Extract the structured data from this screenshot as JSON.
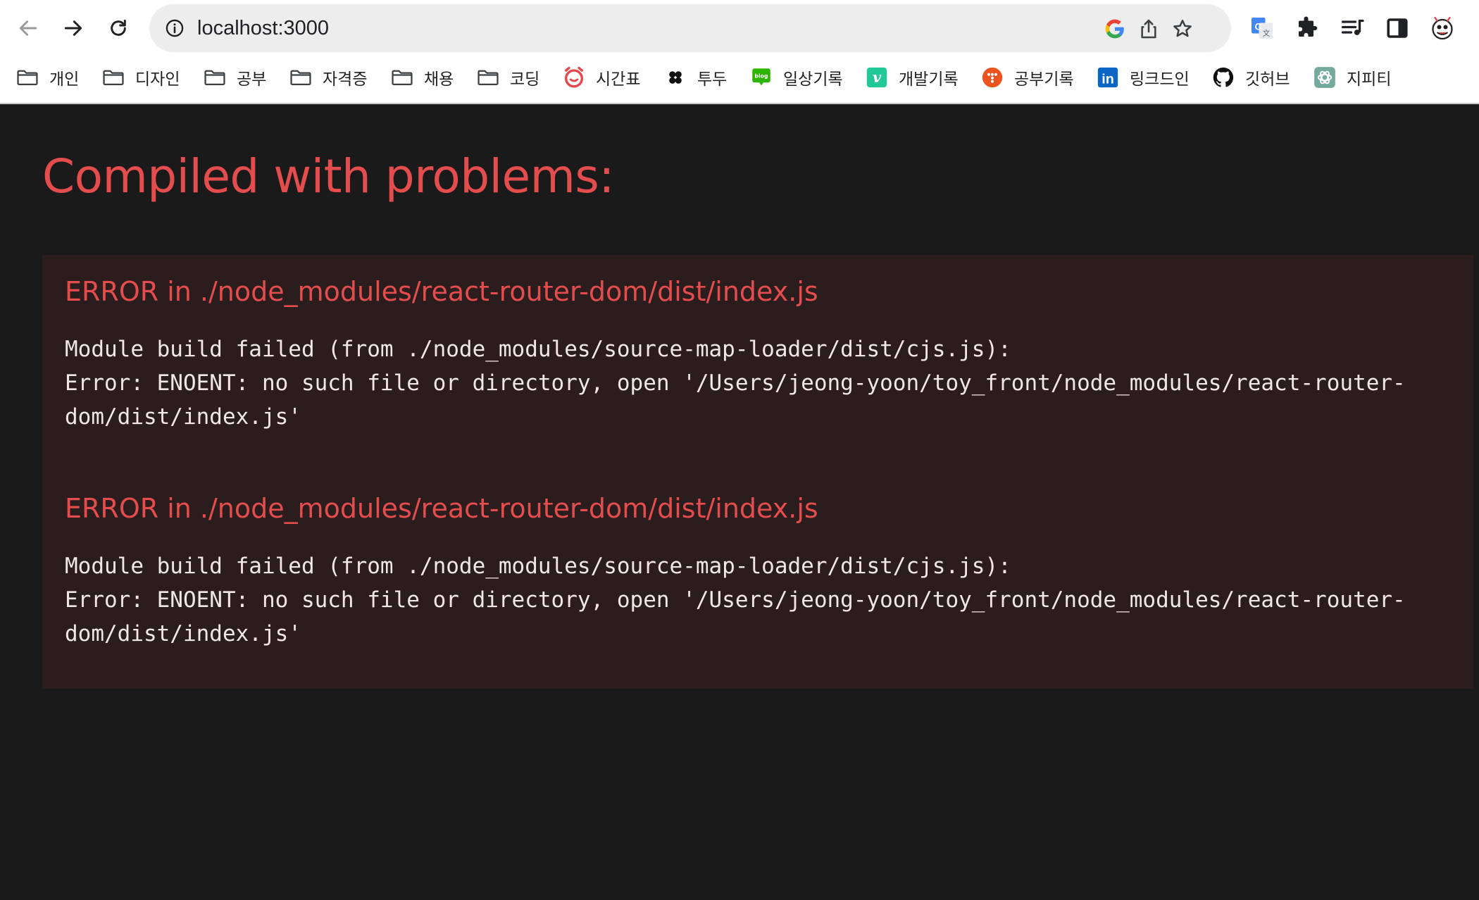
{
  "browser": {
    "url": "localhost:3000",
    "bookmarks": [
      {
        "label": "개인",
        "icon": "folder-icon"
      },
      {
        "label": "디자인",
        "icon": "folder-icon"
      },
      {
        "label": "공부",
        "icon": "folder-icon"
      },
      {
        "label": "자격증",
        "icon": "folder-icon"
      },
      {
        "label": "채용",
        "icon": "folder-icon"
      },
      {
        "label": "코딩",
        "icon": "folder-icon"
      },
      {
        "label": "시간표",
        "icon": "alarm-clock-icon"
      },
      {
        "label": "투두",
        "icon": "todo-icon"
      },
      {
        "label": "일상기록",
        "icon": "blog-icon",
        "icon_text": "blog"
      },
      {
        "label": "개발기록",
        "icon": "velog-icon",
        "icon_text": "v"
      },
      {
        "label": "공부기록",
        "icon": "tistory-icon"
      },
      {
        "label": "링크드인",
        "icon": "linkedin-icon",
        "icon_text": "in"
      },
      {
        "label": "깃허브",
        "icon": "github-icon"
      },
      {
        "label": "지피티",
        "icon": "chatgpt-icon"
      }
    ],
    "colors": {
      "blog_green": "#2db400",
      "velog_green": "#20c997",
      "tistory_orange": "#eb531f",
      "linkedin_blue": "#0a66c2",
      "alarm_red": "#e5484d"
    }
  },
  "page": {
    "title": "Compiled with problems:",
    "errors": [
      {
        "heading": "ERROR in ./node_modules/react-router-dom/dist/index.js",
        "line1": "Module build failed (from ./node_modules/source-map-loader/dist/cjs.js):",
        "line2": "Error: ENOENT: no such file or directory, open '/Users/jeong-yoon/toy_front/node_modules/react-router-",
        "line3": "dom/dist/index.js'"
      },
      {
        "heading": "ERROR in ./node_modules/react-router-dom/dist/index.js",
        "line1": "Module build failed (from ./node_modules/source-map-loader/dist/cjs.js):",
        "line2": "Error: ENOENT: no such file or directory, open '/Users/jeong-yoon/toy_front/node_modules/react-router-",
        "line3": "dom/dist/index.js'"
      }
    ],
    "colors": {
      "background": "#1a1a1a",
      "panel": "#2b1c1d",
      "error_red": "#e44d4d",
      "message_text": "#f3e6e6"
    }
  }
}
